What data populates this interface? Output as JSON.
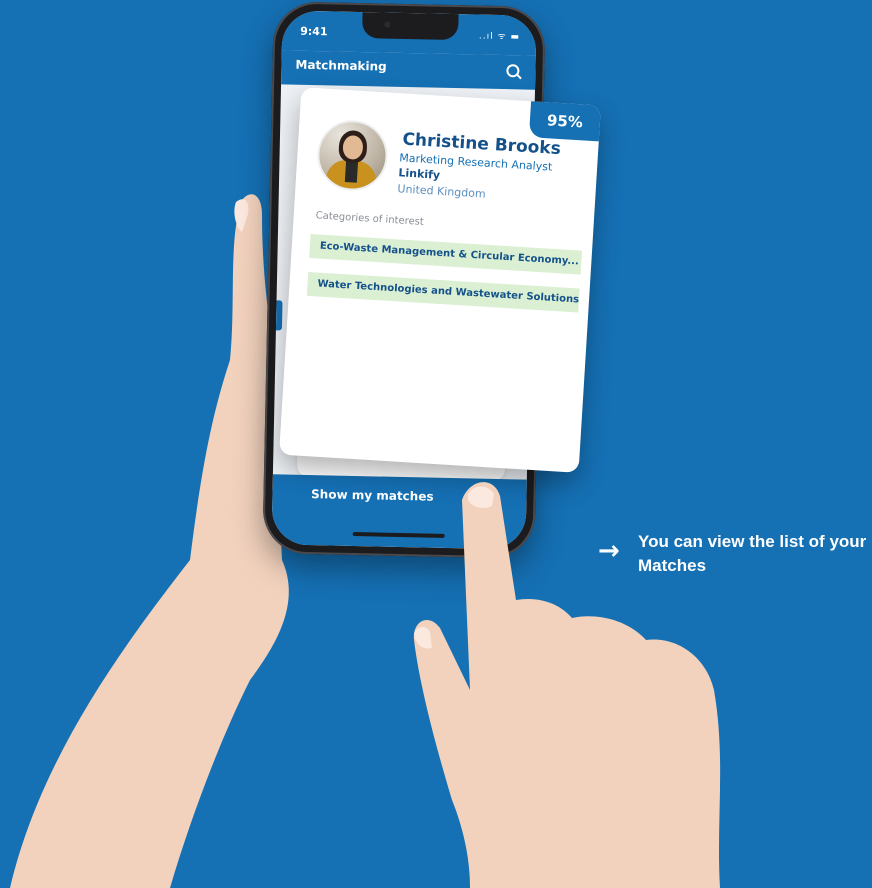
{
  "status_bar": {
    "time": "9:41",
    "icons": "..ıl ᯤ ▬"
  },
  "app_bar": {
    "title": "Matchmaking",
    "search_icon": "search-icon"
  },
  "match_card": {
    "percent": "95%",
    "name": "Christine Brooks",
    "role": "Marketing Research Analyst",
    "company": "Linkify",
    "country": "United Kingdom",
    "interests_label": "Categories of interest",
    "interests": [
      "Eco-Waste Management & Circular Economy...",
      "Water Technologies and Wastewater Solutions"
    ]
  },
  "bottom": {
    "button_label": "Show my matches",
    "arrow": "→"
  },
  "hint": {
    "arrow": "→",
    "text": "You can view the list of your Matches"
  },
  "colors": {
    "brand_blue": "#1570b4",
    "chip_green": "#dbf0d3",
    "name_blue": "#14518a"
  }
}
